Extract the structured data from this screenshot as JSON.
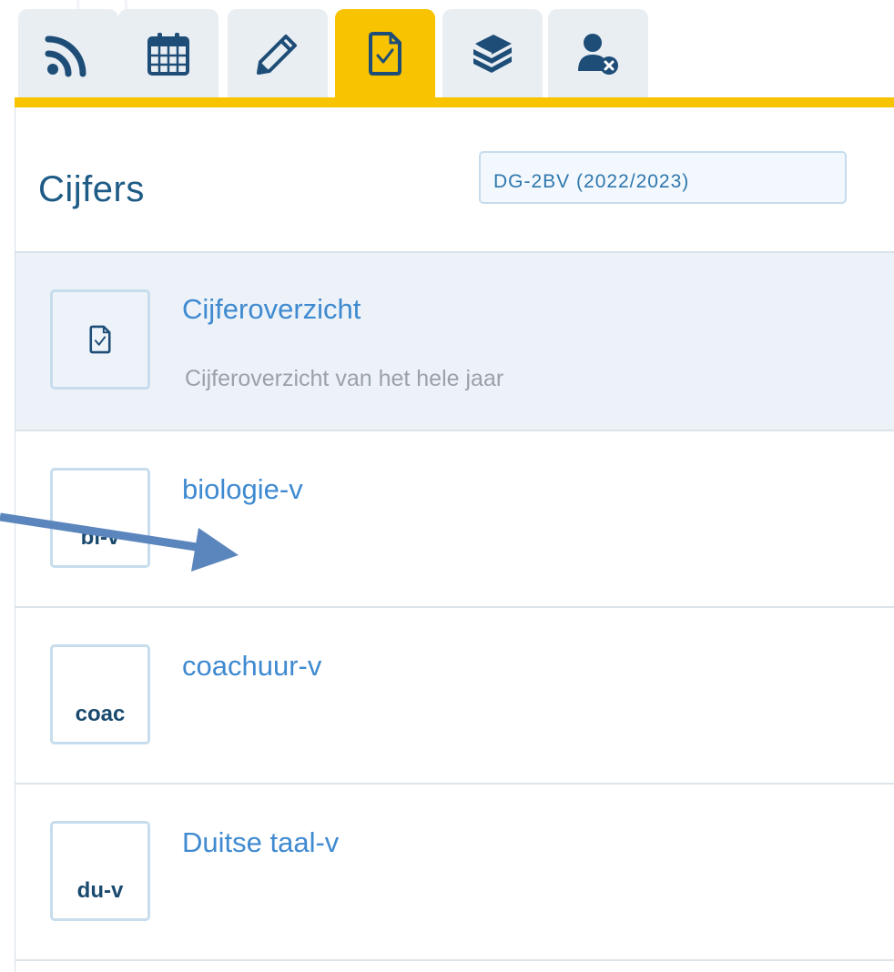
{
  "tabs": [
    {
      "name": "feed",
      "icon": "rss-icon",
      "active": false
    },
    {
      "name": "agenda",
      "icon": "calendar-icon",
      "active": false
    },
    {
      "name": "edit",
      "icon": "pencil-icon",
      "active": false
    },
    {
      "name": "grades",
      "icon": "file-check-icon",
      "active": true
    },
    {
      "name": "books",
      "icon": "books-icon",
      "active": false
    },
    {
      "name": "absences",
      "icon": "user-remove-icon",
      "active": false
    }
  ],
  "colors": {
    "accent": "#f8c300",
    "title": "#1d5b86",
    "link": "#3f8ad0",
    "tab_bg": "#e9eef3",
    "annotation_arrow": "#5b86bd"
  },
  "header": {
    "title": "Cijfers",
    "year_select": "DG-2BV (2022/2023)"
  },
  "list": {
    "overview": {
      "title": "Cijferoverzicht",
      "subtitle": "Cijferoverzicht van het hele jaar",
      "icon": "file-check-icon"
    },
    "subjects": [
      {
        "abbr": "bi-v",
        "name": "biologie-v"
      },
      {
        "abbr": "coac",
        "name": "coachuur-v"
      },
      {
        "abbr": "du-v",
        "name": "Duitse taal-v"
      }
    ]
  }
}
